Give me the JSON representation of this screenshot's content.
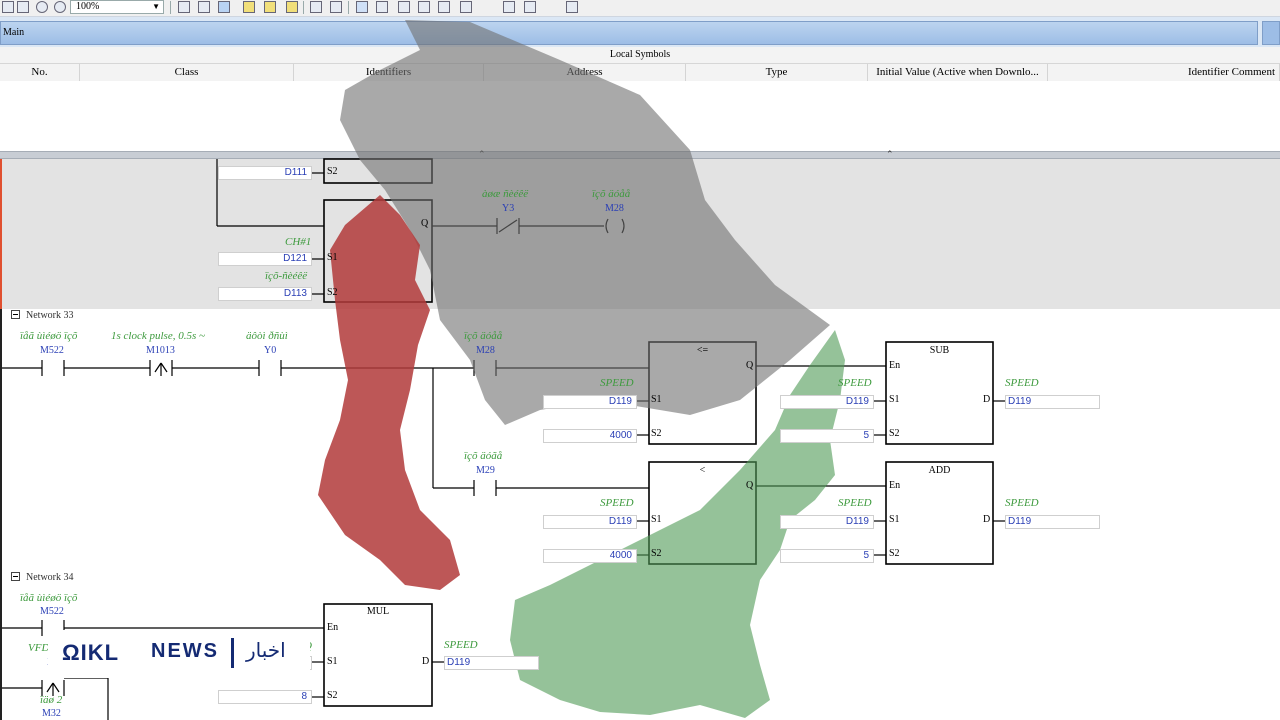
{
  "toolbar": {
    "zoom": "100%"
  },
  "tabs": {
    "main": "Main"
  },
  "local_symbols": {
    "title": "Local Symbols",
    "columns": [
      "No.",
      "Class",
      "Identifiers",
      "Address",
      "Type",
      "Initial Value (Active when Downlo...",
      "Identifier Comment"
    ]
  },
  "network32": {
    "d111": "D111",
    "d121": "D121",
    "d113": "D113",
    "ch_comment": "CH#1",
    "d113_comment": "ïçõ-ñèéêë",
    "y3_comment": "àøæ ñèéêë",
    "y3": "Y3",
    "m28_comment": "ïçõ äóåå",
    "m28": "M28",
    "pins": {
      "s1": "S1",
      "s2": "S2",
      "q": "Q",
      "s2_top": "S2"
    }
  },
  "network33": {
    "label": "Network 33",
    "m522_comment": "ïåã ùìéøö ïçõ",
    "m522": "M522",
    "m1013_comment": "1s clock pulse, 0.5s ~",
    "m1013": "M1013",
    "y0_comment": "äôòì ðñùì",
    "y0": "Y0",
    "m28_comment": "ïçõ äóåå",
    "m28": "M28",
    "m29_comment": "ïçõ äóãå",
    "m29": "M29",
    "cmp1": {
      "title": "<=",
      "s1_comment": "SPEED",
      "s1": "D119",
      "s2": "4000"
    },
    "cmp2": {
      "title": "<",
      "s1_comment": "SPEED",
      "s1": "D119",
      "s2": "4000"
    },
    "sub": {
      "title": "SUB",
      "s1_comment": "SPEED",
      "s1": "D119",
      "s2": "5",
      "d_comment": "SPEED",
      "d": "D119"
    },
    "add": {
      "title": "ADD",
      "s1_comment": "SPEED",
      "s1": "D119",
      "s2": "5",
      "d_comment": "SPEED",
      "d": "D119"
    },
    "pins": {
      "en": "En",
      "s1": "S1",
      "s2": "S2",
      "q": "Q",
      "d": "D"
    }
  },
  "network34": {
    "label": "Network 34",
    "m522_comment": "ïåã ùìéøö ïçõ",
    "m522": "M522",
    "vfd_comment": "VFD",
    "x_partial": "X",
    "m32_comment": "ïäø 2",
    "m32": "M32",
    "mul": {
      "title": "MUL",
      "d_comment": "SPEED",
      "d": "D119",
      "s2": "8",
      "s1_partial": "9",
      "s1_comment_partial": "Q"
    },
    "pins": {
      "en": "En",
      "s1": "S1",
      "s2": "S2",
      "d": "D"
    }
  },
  "badge": {
    "logo": "ΩIKL",
    "news": "NEWS",
    "arabic": "اخبار"
  }
}
